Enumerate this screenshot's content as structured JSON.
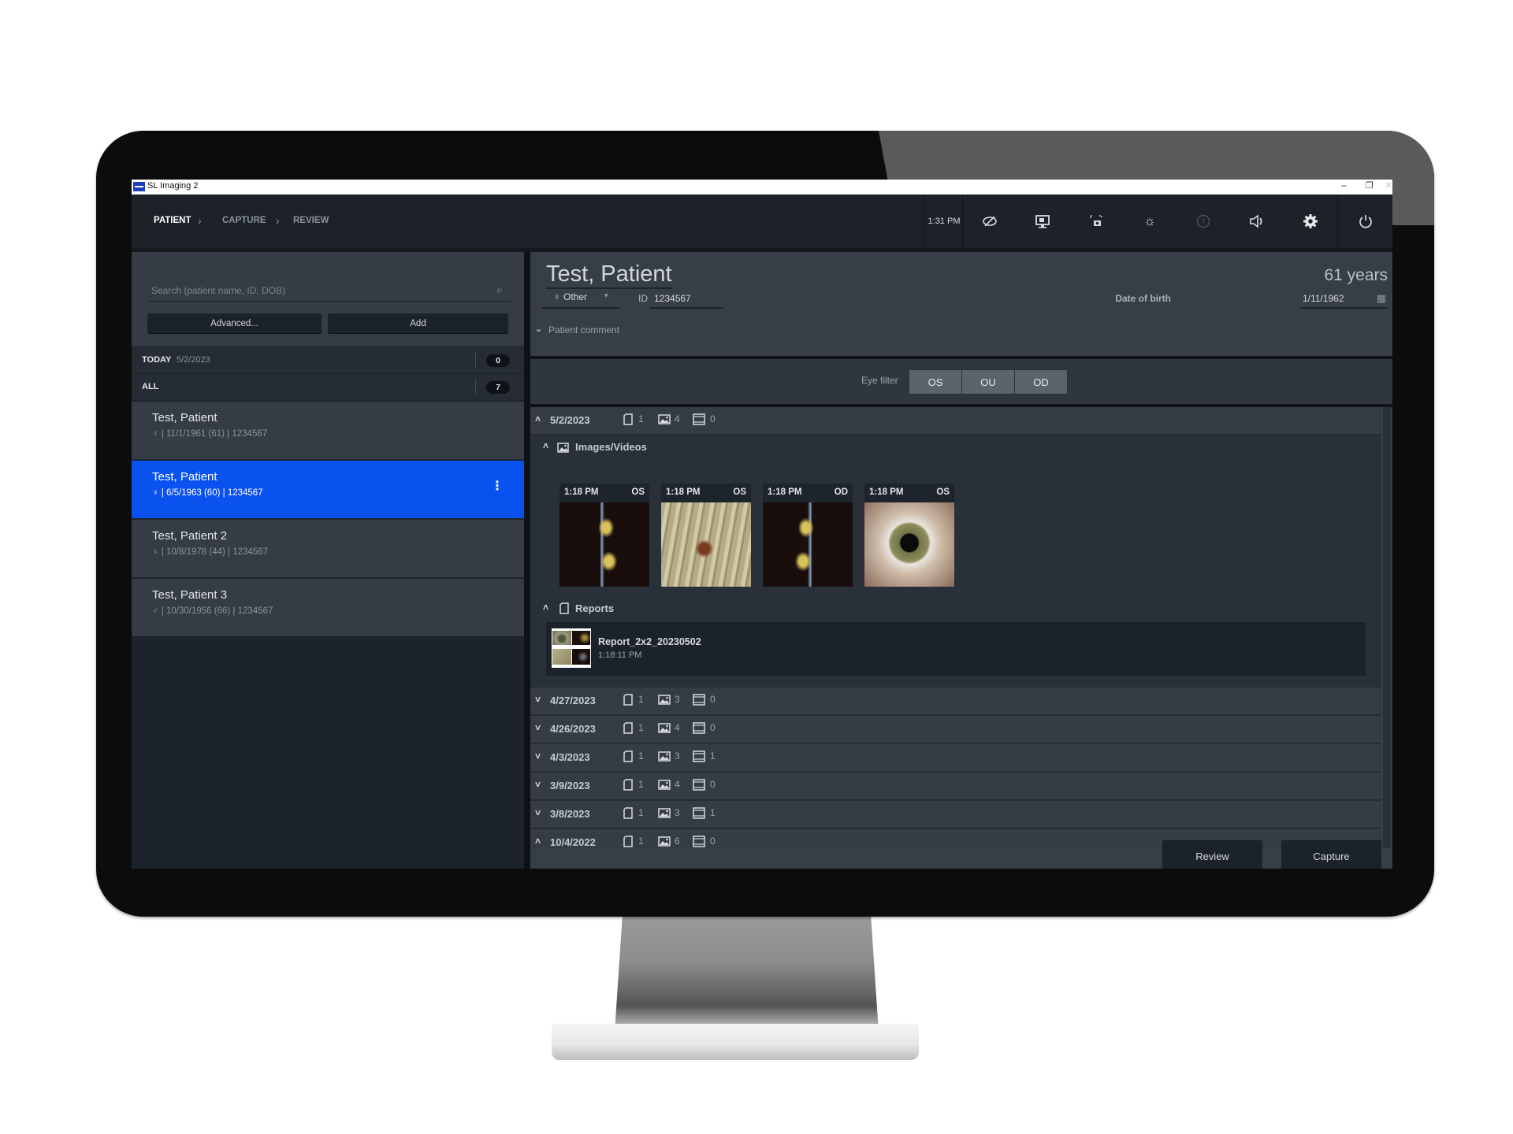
{
  "window": {
    "title": "SL Imaging 2",
    "controls": [
      "minimize",
      "restore",
      "close"
    ]
  },
  "header": {
    "breadcrumb": [
      {
        "label": "PATIENT",
        "active": true
      },
      {
        "label": "CAPTURE",
        "active": false
      },
      {
        "label": "REVIEW",
        "active": false
      }
    ],
    "time": "1:31 PM",
    "icons": [
      "eye-off-icon",
      "monitor-video-icon",
      "camera-capture-icon",
      "brightness-icon",
      "help-icon",
      "volume-icon",
      "settings-icon",
      "power-icon"
    ]
  },
  "left_panel": {
    "search": {
      "placeholder": "Search (patient name, ID, DOB)",
      "value": ""
    },
    "buttons": {
      "advanced": "Advanced...",
      "add": "Add"
    },
    "groups": [
      {
        "label": "TODAY",
        "date": "5/2/2023",
        "count": "0"
      },
      {
        "label": "ALL",
        "date": "",
        "count": "7"
      }
    ],
    "patients": [
      {
        "name": "Test, Patient",
        "gender_icon": "♀",
        "dob": "11/1/1961 (61)",
        "id": "1234567",
        "selected": false
      },
      {
        "name": "Test, Patient",
        "gender_icon": "♀",
        "dob": "6/5/1963 (60)",
        "id": "1234567",
        "selected": true
      },
      {
        "name": "Test, Patient 2",
        "gender_icon": "♀",
        "dob": "10/8/1978 (44)",
        "id": "1234567",
        "selected": false
      },
      {
        "name": "Test, Patient 3",
        "gender_icon": "♂",
        "dob": "10/30/1956 (66)",
        "id": "1234567",
        "selected": false
      }
    ]
  },
  "patient": {
    "name": "Test, Patient",
    "age": "61 years",
    "gender": "Other",
    "id_label": "ID",
    "id": "1234567",
    "dob_label": "Date of birth",
    "dob": "1/11/1962",
    "comment_label": "Patient comment"
  },
  "eye_filter": {
    "label": "Eye filter",
    "options": [
      "OS",
      "OU",
      "OD"
    ]
  },
  "visits": [
    {
      "date": "5/2/2023",
      "reports": "1",
      "images": "4",
      "videos": "0",
      "expanded": true
    },
    {
      "date": "4/27/2023",
      "reports": "1",
      "images": "3",
      "videos": "0",
      "expanded": false
    },
    {
      "date": "4/26/2023",
      "reports": "1",
      "images": "4",
      "videos": "0",
      "expanded": false
    },
    {
      "date": "4/3/2023",
      "reports": "1",
      "images": "3",
      "videos": "1",
      "expanded": false
    },
    {
      "date": "3/9/2023",
      "reports": "1",
      "images": "4",
      "videos": "0",
      "expanded": false
    },
    {
      "date": "3/8/2023",
      "reports": "1",
      "images": "3",
      "videos": "1",
      "expanded": false
    },
    {
      "date": "10/4/2022",
      "reports": "1",
      "images": "6",
      "videos": "0",
      "expanded": true
    }
  ],
  "expanded_visit": {
    "images_label": "Images/Videos",
    "images": [
      {
        "time": "1:18 PM",
        "eye": "OS",
        "kind": "slit-lamp-section"
      },
      {
        "time": "1:18 PM",
        "eye": "OS",
        "kind": "iris-closeup"
      },
      {
        "time": "1:18 PM",
        "eye": "OD",
        "kind": "slit-lamp-section"
      },
      {
        "time": "1:18 PM",
        "eye": "OS",
        "kind": "external-eye"
      }
    ],
    "reports_label": "Reports",
    "report": {
      "name": "Report_2x2_20230502",
      "time": "1:18:11 PM"
    }
  },
  "footer": {
    "review": "Review",
    "capture": "Capture"
  },
  "colors": {
    "accent": "#0a52ef",
    "panel": "#373e47",
    "header": "#1d2228"
  }
}
